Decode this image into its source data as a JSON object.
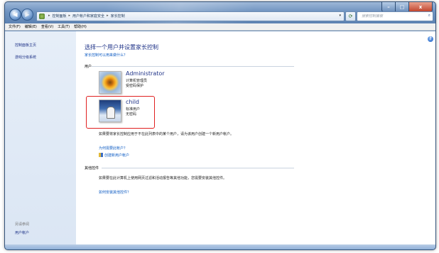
{
  "titlebar": {
    "minimize": "–",
    "maximize": "□",
    "close": "x"
  },
  "address": {
    "crumbs": [
      "控制面板",
      "用户帐户和家庭安全",
      "家长控制"
    ],
    "separator": "▸",
    "dropdown": "▾"
  },
  "search": {
    "placeholder": "搜索控制面板",
    "icon": "search-icon"
  },
  "menu": [
    "文件(F)",
    "编辑(E)",
    "查看(V)",
    "工具(T)",
    "帮助(H)"
  ],
  "sidebar": {
    "home": "控制面板主页",
    "game_ratings": "游戏分级系统",
    "see_also": "另请参阅",
    "user_accounts": "用户帐户"
  },
  "main": {
    "title": "选择一个用户并设置家长控制",
    "what_can_do": "家长控制可以用来做什么？",
    "users_heading": "用户",
    "users": [
      {
        "name": "Administrator",
        "role": "计算机管理员",
        "password": "受密码保护",
        "avatar": "flower"
      },
      {
        "name": "child",
        "role": "标准用户",
        "password": "无密码",
        "avatar": "child"
      }
    ],
    "info_text": "如果要将家长控制应用于不在此列表中的某个用户，请为该用户创建一个新用户帐户。",
    "why_need_account": "为何需要此帐户？",
    "create_account": "创建新用户帐户",
    "other_controls_heading": "其他控件",
    "other_text": "如果要在此计算机上使用网页过滤和活动报告等其他功能，您需要安装其他控件。",
    "how_install": "如何安装其他控件？"
  }
}
